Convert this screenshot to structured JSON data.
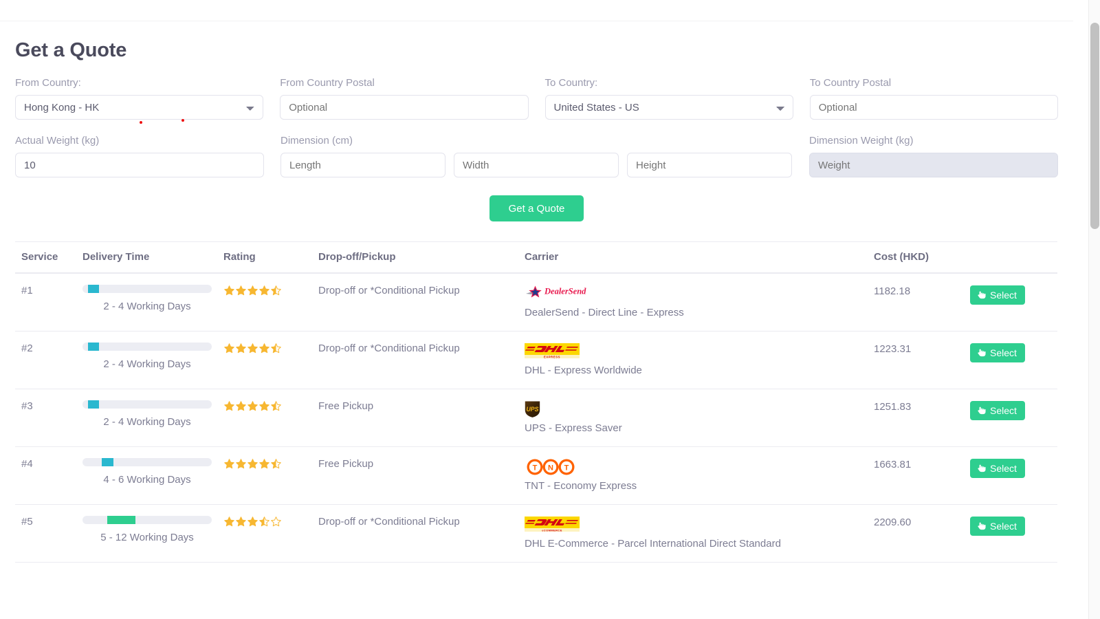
{
  "page": {
    "title": "Get a Quote"
  },
  "form": {
    "from_country": {
      "label": "From Country:",
      "value": "Hong Kong - HK"
    },
    "from_postal": {
      "label": "From Country Postal",
      "placeholder": "Optional",
      "value": ""
    },
    "to_country": {
      "label": "To Country:",
      "value": "United States - US"
    },
    "to_postal": {
      "label": "To Country Postal",
      "placeholder": "Optional",
      "value": ""
    },
    "actual_weight": {
      "label": "Actual Weight (kg)",
      "value": "10"
    },
    "dimension": {
      "label": "Dimension (cm)",
      "length_placeholder": "Length",
      "width_placeholder": "Width",
      "height_placeholder": "Height"
    },
    "dimension_weight": {
      "label": "Dimension Weight (kg)",
      "placeholder": "Weight",
      "value": "",
      "disabled": true
    },
    "submit_label": "Get a Quote"
  },
  "table": {
    "headers": {
      "service": "Service",
      "delivery_time": "Delivery Time",
      "rating": "Rating",
      "dropoff": "Drop-off/Pickup",
      "carrier": "Carrier",
      "cost": "Cost (HKD)"
    },
    "rows": [
      {
        "service": "#1",
        "delivery_time": "2 - 4 Working Days",
        "bar": {
          "start_pct": 4,
          "width_pct": 9,
          "color": "#2ab8cf"
        },
        "rating": 4.5,
        "dropoff": "Drop-off or *Conditional Pickup",
        "carrier_logo": "dealersend-logo",
        "carrier_name": "DealerSend - Direct Line - Express",
        "cost": "1182.18",
        "action_label": "Select"
      },
      {
        "service": "#2",
        "delivery_time": "2 - 4 Working Days",
        "bar": {
          "start_pct": 4,
          "width_pct": 9,
          "color": "#2ab8cf"
        },
        "rating": 4.5,
        "dropoff": "Drop-off or *Conditional Pickup",
        "carrier_logo": "dhl-express-logo",
        "carrier_name": "DHL - Express Worldwide",
        "cost": "1223.31",
        "action_label": "Select"
      },
      {
        "service": "#3",
        "delivery_time": "2 - 4 Working Days",
        "bar": {
          "start_pct": 4,
          "width_pct": 9,
          "color": "#2ab8cf"
        },
        "rating": 4.5,
        "dropoff": "Free Pickup",
        "carrier_logo": "ups-logo",
        "carrier_name": "UPS - Express Saver",
        "cost": "1251.83",
        "action_label": "Select"
      },
      {
        "service": "#4",
        "delivery_time": "4 - 6 Working Days",
        "bar": {
          "start_pct": 15,
          "width_pct": 9,
          "color": "#2ab8cf"
        },
        "rating": 4.5,
        "dropoff": "Free Pickup",
        "carrier_logo": "tnt-logo",
        "carrier_name": "TNT - Economy Express",
        "cost": "1663.81",
        "action_label": "Select"
      },
      {
        "service": "#5",
        "delivery_time": "5 - 12 Working Days",
        "bar": {
          "start_pct": 19,
          "width_pct": 22,
          "color": "#2ece8f"
        },
        "rating": 3.5,
        "dropoff": "Drop-off or *Conditional Pickup",
        "carrier_logo": "dhl-ecommerce-logo",
        "carrier_name": "DHL E-Commerce - Parcel International Direct Standard",
        "cost": "2209.60",
        "action_label": "Select"
      }
    ]
  },
  "colors": {
    "accent_green": "#2ece8f",
    "bar_teal": "#2ab8cf",
    "star_gold": "#f7b731",
    "text_muted": "#7c7c92"
  }
}
